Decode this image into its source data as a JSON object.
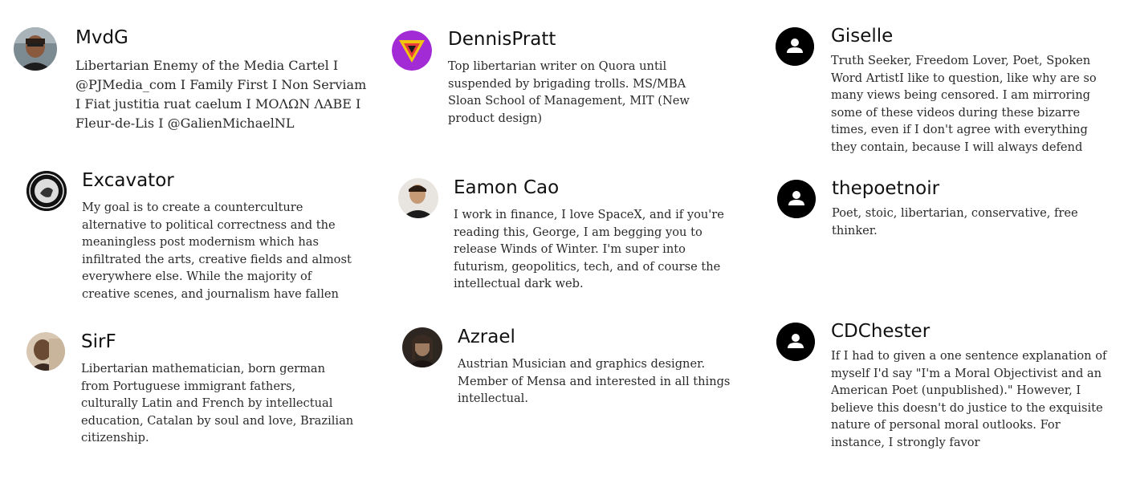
{
  "profiles": [
    {
      "name": "MvdG",
      "bio": "Libertarian Enemy of the Media Cartel I @PJMedia_com I Family First I Non Serviam I Fiat justitia ruat caelum I ΜΟΛΩΝ ΛΑΒΕ I Fleur-de-Lis I @GalienMichaelNL",
      "avatar": "user-photo"
    },
    {
      "name": "DennisPratt",
      "bio": "Top libertarian writer on Quora until suspended by brigading trolls.   MS/MBA Sloan School of Management, MIT (New product design)",
      "avatar": "triangle-logo"
    },
    {
      "name": "Giselle",
      "bio": "Truth Seeker, Freedom Lover, Poet, Spoken Word ArtistI like to question, like why are so many views being censored.  I am mirroring some of these videos during these bizarre times, even if I don't agree with everything they contain, because I will always defend",
      "avatar": "default-user"
    },
    {
      "name": "Excavator",
      "bio": "My goal is to create a counterculture alternative to political correctness and the meaningless post modernism which has infiltrated the arts, creative fields and almost everywhere else. While the majority of creative scenes, and journalism have fallen",
      "avatar": "seal-logo"
    },
    {
      "name": "Eamon Cao",
      "bio": "I work in finance, I love SpaceX, and if you're reading this, George, I am begging you to release Winds of Winter. I'm super into futurism, geopolitics, tech, and of course the intellectual dark web.",
      "avatar": "user-photo"
    },
    {
      "name": "thepoetnoir",
      "bio": "Poet, stoic, libertarian, conservative, free thinker.",
      "avatar": "default-user"
    },
    {
      "name": "SirF",
      "bio": "Libertarian mathematician, born german from Portuguese immigrant fathers, culturally Latin and French by intellectual education, Catalan by soul and love, Brazilian citizenship.",
      "avatar": "user-photo"
    },
    {
      "name": "Azrael",
      "bio": "Austrian Musician and graphics designer. Member of Mensa and interested in all things intellectual.",
      "avatar": "user-photo"
    },
    {
      "name": "CDChester",
      "bio": "If I had to given a one sentence explanation of myself I'd say \"I'm a Moral Objectivist and an American Poet (unpublished).\" However, I believe this doesn't do justice to the exquisite nature of personal moral outlooks. For instance, I strongly favor",
      "avatar": "default-user"
    }
  ]
}
